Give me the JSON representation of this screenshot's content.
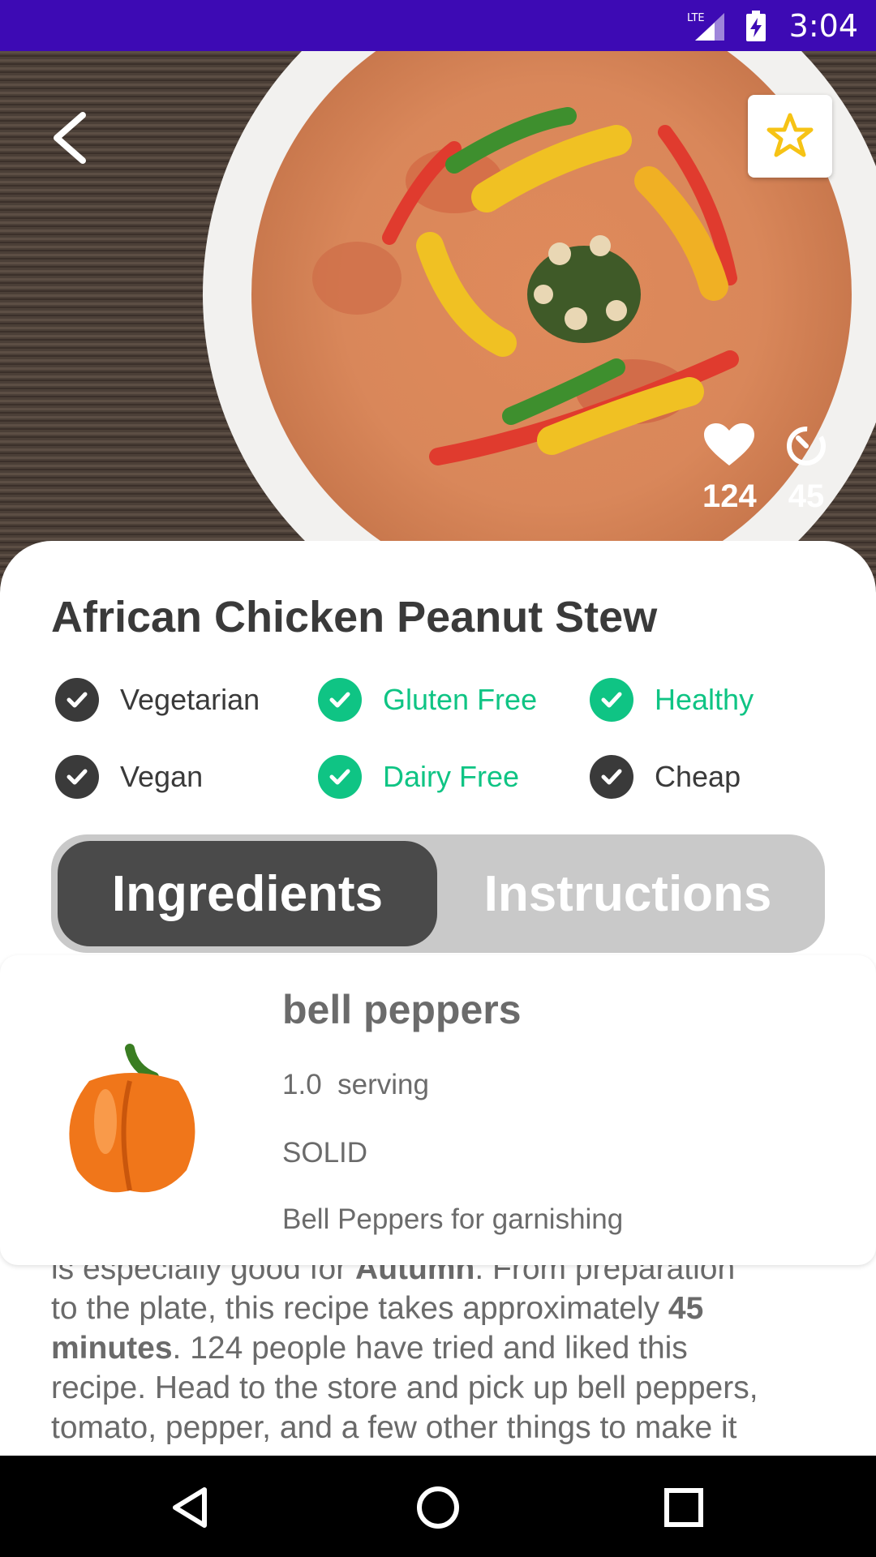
{
  "status_bar": {
    "time": "3:04",
    "network": "LTE"
  },
  "hero": {
    "likes": "124",
    "minutes": "45",
    "icons": {
      "back": "back-arrow-icon",
      "favorite": "star-outline-icon",
      "like": "heart-icon",
      "time": "timer-icon"
    },
    "colors": {
      "favorite_star": "#f6c315"
    }
  },
  "recipe": {
    "title": "African Chicken Peanut Stew",
    "tags": [
      {
        "label": "Vegetarian",
        "active": false
      },
      {
        "label": "Gluten Free",
        "active": true
      },
      {
        "label": "Healthy",
        "active": true
      },
      {
        "label": "Vegan",
        "active": false
      },
      {
        "label": "Dairy Free",
        "active": true
      },
      {
        "label": "Cheap",
        "active": false
      }
    ],
    "colors": {
      "active": "#0fc484",
      "inactive": "#3a3a3a"
    }
  },
  "tabs": {
    "ingredients": "Ingredients",
    "instructions": "Instructions",
    "selected": "Ingredients"
  },
  "ingredient": {
    "name": "bell peppers",
    "amount": "1.0",
    "unit": "serving",
    "consistency": "SOLID",
    "original": "Bell Peppers for garnishing"
  },
  "description": {
    "line1_pre": "is especially good for ",
    "line1_bold": "Autumn",
    "line1_post": ". From preparation",
    "line2_pre": "to the plate, this recipe takes approximately ",
    "line2_bold": "45",
    "line3_bold": "minutes",
    "line3_post": ". 124 people have tried and liked this",
    "line4": "recipe. Head to the store and pick up bell peppers,",
    "line5": "tomato, pepper, and a few other things to make it"
  }
}
